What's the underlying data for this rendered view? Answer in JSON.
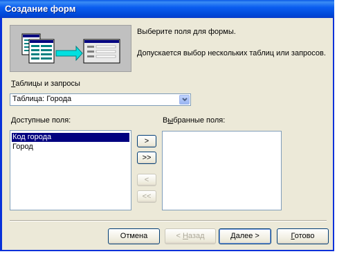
{
  "window": {
    "title": "Создание форм"
  },
  "intro": {
    "line1": "Выберите поля для формы.",
    "line2": "Допускается выбор нескольких таблиц или запросов."
  },
  "tables": {
    "label_u": "Т",
    "label_rest": "аблицы и запросы",
    "selected": "Таблица: Города"
  },
  "available": {
    "label_u": "Д",
    "label_rest": "оступные поля:",
    "items": [
      "Код города",
      "Город"
    ]
  },
  "selected_fields": {
    "label_pre": "В",
    "label_u": "ы",
    "label_rest": "бранные поля:",
    "items": []
  },
  "move_buttons": {
    "add_one": ">",
    "add_all": ">>",
    "remove_one": "<",
    "remove_all": "<<"
  },
  "footer": {
    "cancel": "Отмена",
    "back_pre": "< ",
    "back_u": "Н",
    "back_rest": "азад",
    "next_u": "Д",
    "next_rest": "алее >",
    "finish_u": "Г",
    "finish_rest": "отово"
  }
}
